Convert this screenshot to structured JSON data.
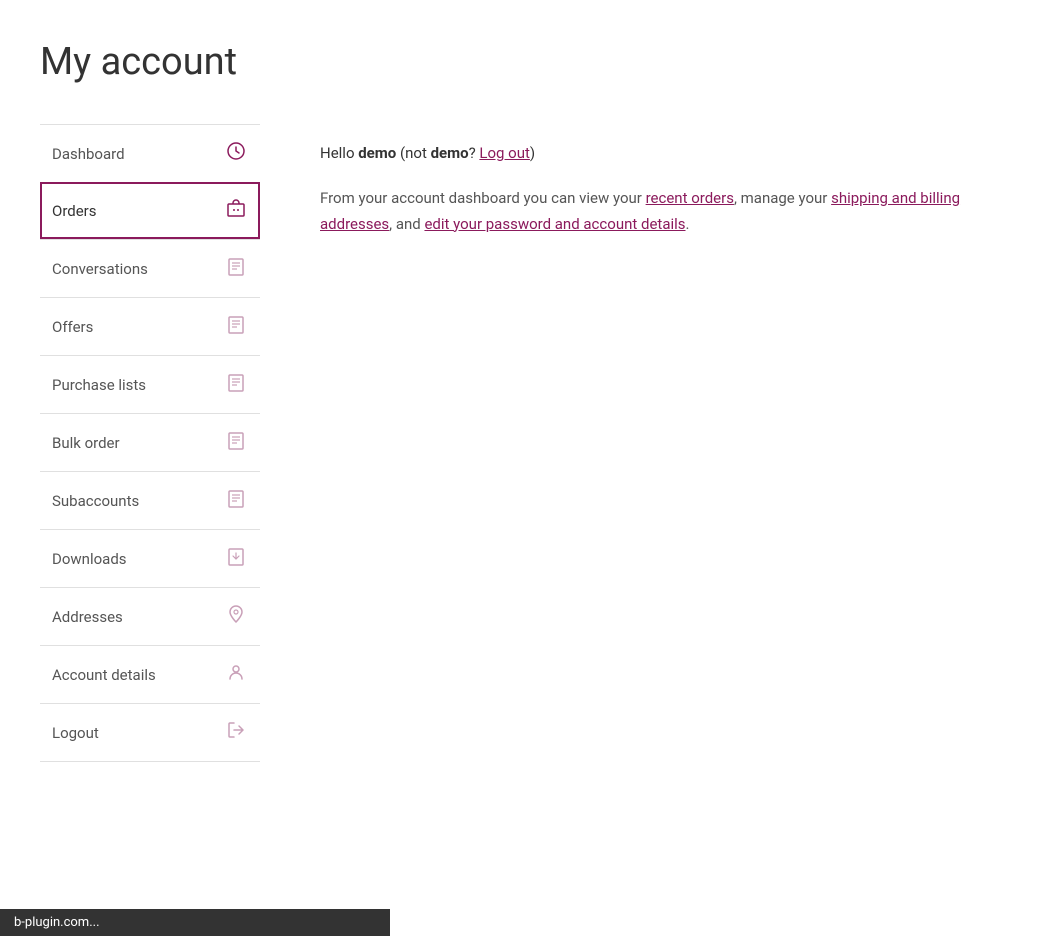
{
  "page": {
    "title": "My account"
  },
  "hello": {
    "prefix": "Hello ",
    "username": "demo",
    "not_text": " (not ",
    "username2": "demo",
    "question": "? ",
    "logout_label": "Log out",
    "suffix": ")"
  },
  "description": {
    "text_before": "From your account dashboard you can view your ",
    "link1": "recent orders",
    "text_middle1": ", manage your ",
    "link2": "shipping and billing addresses",
    "text_middle2": ", and ",
    "link3": "edit your password and account details",
    "text_end": "."
  },
  "sidebar": {
    "items": [
      {
        "id": "dashboard",
        "label": "Dashboard",
        "icon": "dashboard",
        "active": false
      },
      {
        "id": "orders",
        "label": "Orders",
        "icon": "orders",
        "active": true
      },
      {
        "id": "conversations",
        "label": "Conversations",
        "icon": "conversations",
        "active": false
      },
      {
        "id": "offers",
        "label": "Offers",
        "icon": "offers",
        "active": false
      },
      {
        "id": "purchase-lists",
        "label": "Purchase lists",
        "icon": "purchase-lists",
        "active": false
      },
      {
        "id": "bulk-order",
        "label": "Bulk order",
        "icon": "bulk-order",
        "active": false
      },
      {
        "id": "subaccounts",
        "label": "Subaccounts",
        "icon": "subaccounts",
        "active": false
      },
      {
        "id": "downloads",
        "label": "Downloads",
        "icon": "downloads",
        "active": false
      },
      {
        "id": "addresses",
        "label": "Addresses",
        "icon": "addresses",
        "active": false
      },
      {
        "id": "account-details",
        "label": "Account details",
        "icon": "account-details",
        "active": false
      },
      {
        "id": "logout",
        "label": "Logout",
        "icon": "logout",
        "active": false
      }
    ]
  },
  "status_bar": {
    "text": "b-plugin.com..."
  }
}
